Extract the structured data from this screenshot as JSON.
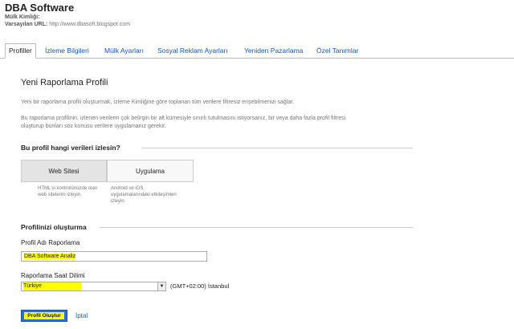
{
  "header": {
    "title": "DBA Software",
    "property_id_label": "Mülk Kimliği:",
    "default_url_label": "Varsayılan URL:",
    "default_url": "http://www.dbasoft.blogspot.com"
  },
  "tabs": [
    {
      "label": "Profiller"
    },
    {
      "label": "İzleme Bilgileri"
    },
    {
      "label": "Mülk Ayarları"
    },
    {
      "label": "Sosyal Reklam Ayarları"
    },
    {
      "label": "Yeniden Pazarlama"
    },
    {
      "label": "Özel Tanımlar"
    }
  ],
  "main": {
    "heading": "Yeni Raporlama Profili",
    "intro": "Yeni bir raporlama profili oluşturmak, İzleme Kimliğine göre toplanan tüm verilere filtresiz erişebilmenizi sağlar.",
    "info_line1": "Bu raporlama profilinin, izlenen verilerin çok belirgin bir alt kümesiyle sınırlı tutulmasını istiyorsanız, bir veya daha fazla profil filtresi",
    "info_line2": "oluşturup bunları söz konusu verilere uygulamanız gerekir.",
    "section1_title": "Bu profil hangi verileri izlesin?",
    "option_web": "Web Sitesi",
    "option_app": "Uygulama",
    "web_desc_line1": "HTML'si kontrolünüzde olan",
    "web_desc_line2": "web sitelerini izleyin",
    "app_desc_line1": "Android ve iOS",
    "app_desc_line2": "uygulamalarındaki etkileşimleri",
    "app_desc_line3": "izleyin",
    "section2_title": "Profilinizi oluşturma",
    "profile_name_label": "Profil Adı Raporlama",
    "profile_name_value": "DBA Software Analiz",
    "timezone_label": "Raporlama Saat Dilimi",
    "country_value": "Türkiye",
    "timezone_value": "(GMT+02:00) İstanbul",
    "create_button": "Profil Oluştur",
    "cancel_link": "İptal"
  },
  "colors": {
    "link": "#1155cc",
    "highlight": "#ffff00",
    "button": "#2a6ddb"
  }
}
